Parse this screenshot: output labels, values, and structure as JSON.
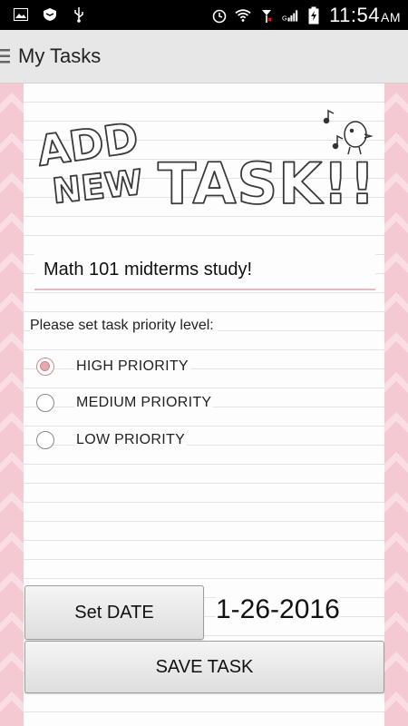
{
  "status_bar": {
    "time": "11:54",
    "ampm": "AM",
    "icons": [
      "image-icon",
      "shield-icon",
      "usb-icon",
      "alarm-icon",
      "wifi-icon",
      "no-signal-icon",
      "signal-bars-icon",
      "battery-charging-icon"
    ]
  },
  "action_bar": {
    "title": "My Tasks",
    "menu_icon": "hamburger-icon"
  },
  "headline": {
    "line1": "ADD",
    "line2": "NEW",
    "line3": "TASK!!"
  },
  "task": {
    "value": "Math 101 midterms study!"
  },
  "priority": {
    "prompt": "Please set task priority level:",
    "options": [
      {
        "label": "HIGH PRIORITY",
        "checked": true
      },
      {
        "label": "MEDIUM PRIORITY",
        "checked": false
      },
      {
        "label": "LOW PRIORITY",
        "checked": false
      }
    ]
  },
  "date": {
    "button_label": "Set DATE",
    "value": "1-26-2016"
  },
  "save": {
    "button_label": "SAVE TASK"
  },
  "colors": {
    "stripe_pink": "#f4c9d2",
    "accent_pink": "#e8a7b0",
    "status_bar": "#000000",
    "action_bar": "#e7e7e7"
  }
}
